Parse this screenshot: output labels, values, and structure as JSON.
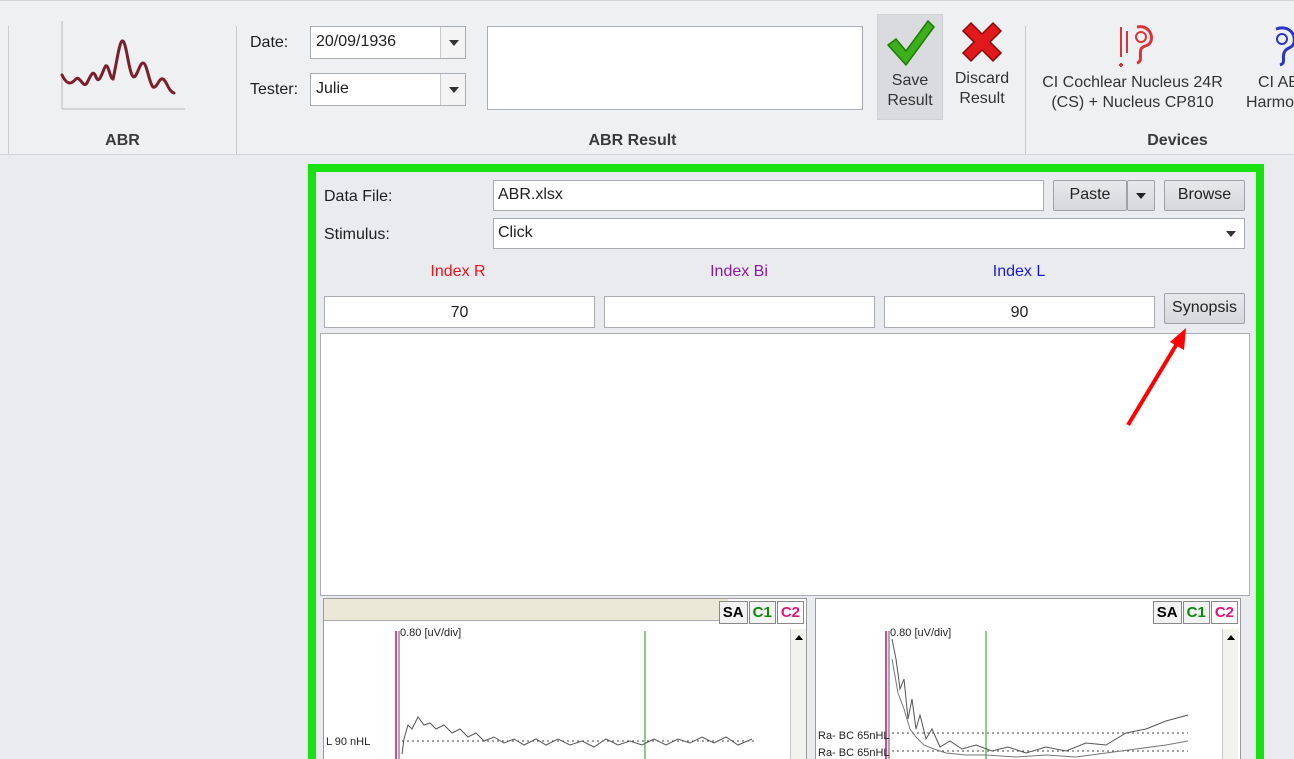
{
  "ribbon": {
    "abr_group": {
      "caption": "ABR"
    },
    "result_group": {
      "caption": "ABR Result",
      "date_label": "Date:",
      "date_value": "20/09/1936",
      "tester_label": "Tester:",
      "tester_value": "Julie",
      "notes_value": "",
      "save": {
        "line1": "Save",
        "line2": "Result",
        "icon": "checkmark-icon",
        "color": "#3cb01a"
      },
      "discard": {
        "line1": "Discard",
        "line2": "Result",
        "icon": "red-x-icon",
        "color": "#e0191d"
      }
    },
    "devices_group": {
      "caption": "Devices",
      "device1": {
        "line1": "CI Cochlear Nucleus 24R",
        "line2": "(CS) + Nucleus CP810",
        "icon": "cochlear-implant-red-icon"
      },
      "device2": {
        "line1": "CI AB",
        "line2": "Harmo",
        "icon": "cochlear-implant-blue-icon"
      }
    }
  },
  "panel": {
    "border_color": "#17e10f",
    "data_file_label": "Data File:",
    "data_file_value": "ABR.xlsx",
    "paste_label": "Paste",
    "browse_label": "Browse",
    "stimulus_label": "Stimulus:",
    "stimulus_value": "Click",
    "index_r": {
      "label": "Index R",
      "value": "70",
      "color": "#e8141c"
    },
    "index_bi": {
      "label": "Index Bi",
      "value": "",
      "color": "#8a1aa0"
    },
    "index_l": {
      "label": "Index L",
      "value": "90",
      "color": "#1b18e6"
    },
    "synopsis_label": "Synopsis"
  },
  "waveforms": {
    "left": {
      "tabs": [
        "SA",
        "C1",
        "C2"
      ],
      "scale": "0.80 [uV/div]",
      "trace_label": "L 90 nHL"
    },
    "right": {
      "tabs": [
        "SA",
        "C1",
        "C2"
      ],
      "scale": "0.80 [uV/div]",
      "trace_label_1": "Ra- BC 65nHL",
      "trace_label_2": "Ra- BC 65nHL"
    }
  },
  "annotation": {
    "arrow_color": "#ff0000"
  }
}
